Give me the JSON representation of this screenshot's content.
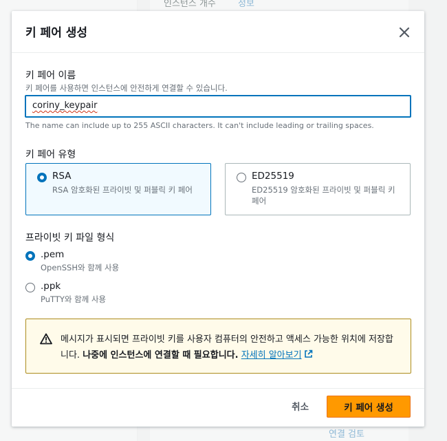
{
  "background": {
    "snips": [
      "인스턴스 개수",
      "정보",
      "연결 검토"
    ]
  },
  "modal": {
    "title": "키 페어 생성",
    "close_icon": "close-icon",
    "name_field": {
      "label": "키 페어 이름",
      "description": "키 페어를 사용하면 인스턴스에 안전하게 연결할 수 있습니다.",
      "value": "coriny_keypair",
      "constraint": "The name can include up to 255 ASCII characters. It can't include leading or trailing spaces."
    },
    "key_type": {
      "label": "키 페어 유형",
      "options": [
        {
          "name": "RSA",
          "description": "RSA 암호화된 프라이빗 및 퍼블릭 키 페어",
          "selected": true
        },
        {
          "name": "ED25519",
          "description": "ED25519 암호화된 프라이빗 및 퍼블릭 키 페어",
          "selected": false
        }
      ]
    },
    "file_format": {
      "label": "프라이빗 키 파일 형식",
      "options": [
        {
          "name": ".pem",
          "description": "OpenSSH와 함께 사용",
          "selected": true
        },
        {
          "name": ".ppk",
          "description": "PuTTY와 함께 사용",
          "selected": false
        }
      ]
    },
    "alert": {
      "icon": "warning-icon",
      "text_before": "메시지가 표시되면 프라이빗 키를 사용자 컴퓨터의 안전하고 액세스 가능한 위치에 저장합니다. ",
      "text_bold": "나중에 인스턴스에 연결할 때 필요합니다.",
      "link_text": "자세히 알아보기",
      "link_icon": "external-link-icon"
    },
    "footer": {
      "cancel_label": "취소",
      "create_label": "키 페어 생성"
    }
  },
  "colors": {
    "accent": "#0073bb",
    "primary_button": "#ff9900",
    "warning_bg": "#fffbea",
    "warning_border": "#ac8b1b"
  }
}
